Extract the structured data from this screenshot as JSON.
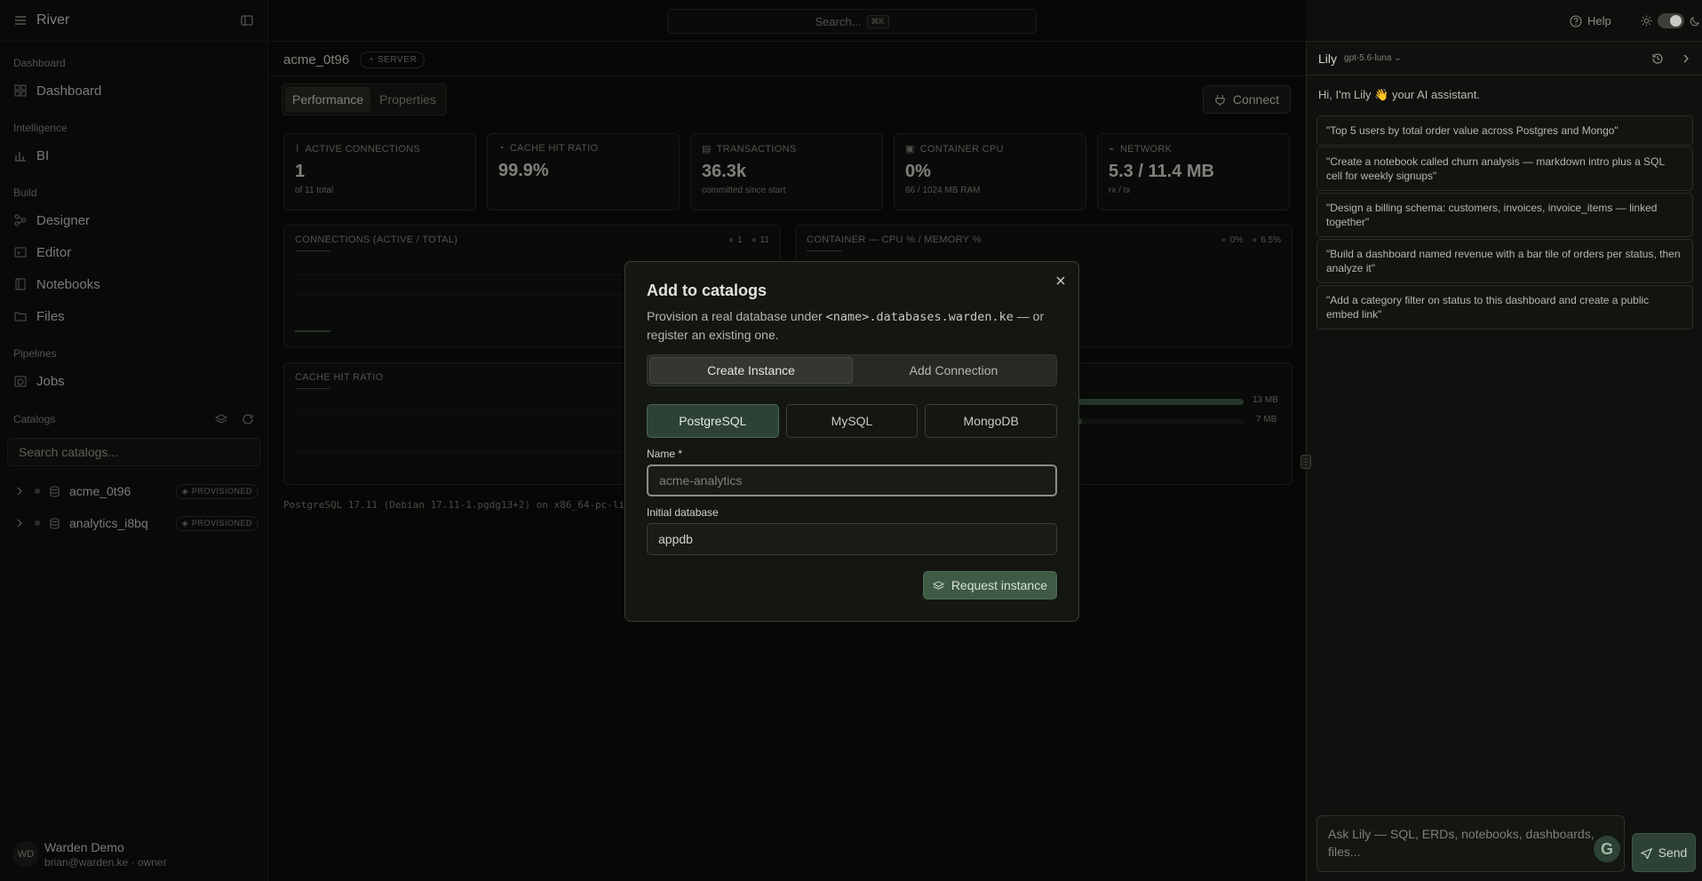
{
  "sidebar": {
    "brand": "River",
    "sections": {
      "dashboard": "Dashboard",
      "intelligence": "Intelligence",
      "build": "Build",
      "pipelines": "Pipelines",
      "catalogs": "Catalogs"
    },
    "items": {
      "dashboard": "Dashboard",
      "bi": "BI",
      "designer": "Designer",
      "editor": "Editor",
      "notebooks": "Notebooks",
      "files": "Files",
      "jobs": "Jobs"
    },
    "catalog_search_placeholder": "Search catalogs...",
    "catalogs": [
      {
        "name": "acme_0t96",
        "badge": "PROVISIONED"
      },
      {
        "name": "analytics_i8bq",
        "badge": "PROVISIONED"
      }
    ],
    "user": {
      "initials": "WD",
      "name": "Warden Demo",
      "email": "brian@warden.ke · owner"
    }
  },
  "topbar": {
    "search_placeholder": "Search...",
    "search_kbd": "⌘K",
    "help": "Help"
  },
  "main": {
    "title": "acme_0t96",
    "badge": "SERVER",
    "tabs": [
      "Performance",
      "Properties"
    ],
    "connect": "Connect",
    "stats": [
      {
        "label": "ACTIVE CONNECTIONS",
        "value": "1",
        "sub": "of 11 total"
      },
      {
        "label": "CACHE HIT RATIO",
        "value": "99.9%",
        "sub": ""
      },
      {
        "label": "TRANSACTIONS",
        "value": "36.3k",
        "sub": "committed since start"
      },
      {
        "label": "CONTAINER CPU",
        "value": "0%",
        "sub": "66 / 1024 MB RAM"
      },
      {
        "label": "NETWORK",
        "value": "5.3 / 11.4 MB",
        "sub": "rx / tx"
      }
    ],
    "panel_connections": {
      "title": "CONNECTIONS (ACTIVE / TOTAL)",
      "legend": [
        "1",
        "11"
      ]
    },
    "panel_container": {
      "title": "CONTAINER — CPU % / MEMORY %",
      "legend": [
        "0%",
        "6.5%"
      ]
    },
    "panel_cache": {
      "title": "CACHE HIT RATIO"
    },
    "memory_bars": [
      {
        "label": "13 MB",
        "fill": 1.0
      },
      {
        "label": "7 MB",
        "fill": 0.09
      }
    ],
    "version": "PostgreSQL 17.11 (Debian 17.11-1.pgdg13+2) on x86_64-pc-li"
  },
  "modal": {
    "title": "Add to catalogs",
    "desc_pre": "Provision a real database under ",
    "desc_code": "<name>.databases.warden.ke",
    "desc_post": " — or register an existing one.",
    "tabs": [
      "Create Instance",
      "Add Connection"
    ],
    "engines": [
      "PostgreSQL",
      "MySQL",
      "MongoDB"
    ],
    "name_label": "Name *",
    "name_placeholder": "acme-analytics",
    "db_label": "Initial database",
    "db_value": "appdb",
    "submit": "Request instance"
  },
  "assistant": {
    "name": "Lily",
    "model": "gpt-5.6-luna",
    "greeting": "Hi, I'm Lily 👋 your AI assistant.",
    "suggestions": [
      "\"Top 5 users by total order value across Postgres and Mongo\"",
      "\"Create a notebook called churn analysis — markdown intro plus a SQL cell for weekly signups\"",
      "\"Design a billing schema: customers, invoices, invoice_items — linked together\"",
      "\"Build a dashboard named revenue with a bar tile of orders per status, then analyze it\"",
      "\"Add a category filter on status to this dashboard and create a public embed link\""
    ],
    "input_placeholder": "Ask Lily — SQL, ERDs, notebooks, dashboards, files...",
    "send": "Send"
  },
  "colors": {
    "accent": "#2d4235",
    "accent_border": "#4a6a53",
    "background": "#0d0f0c"
  }
}
